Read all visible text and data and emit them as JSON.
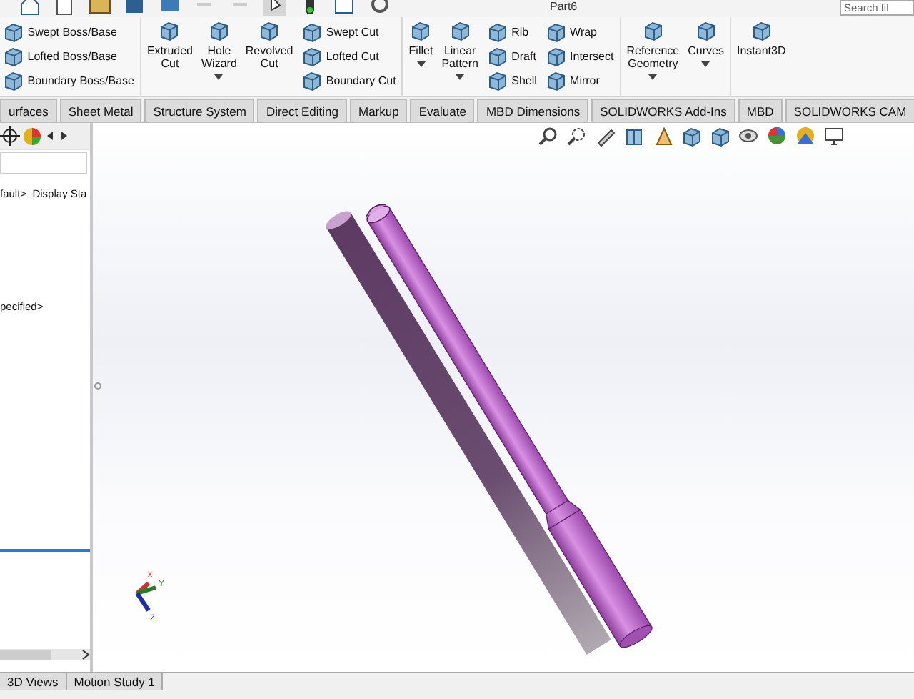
{
  "top_bar": {
    "title": "Part6",
    "search": {
      "placeholder": "Search fil"
    }
  },
  "ribbon": [
    {
      "columns": [
        {
          "kind": "stack",
          "items": [
            {
              "label": "Swept Boss/Base"
            },
            {
              "label": "Lofted Boss/Base"
            },
            {
              "label": "Boundary Boss/Base"
            }
          ]
        }
      ]
    },
    {
      "columns": [
        {
          "kind": "large",
          "label": "Extruded Cut",
          "dropdown": false
        },
        {
          "kind": "large",
          "label": "Hole Wizard",
          "dropdown": true
        },
        {
          "kind": "large",
          "label": "Revolved Cut",
          "dropdown": false
        },
        {
          "kind": "stack",
          "items": [
            {
              "label": "Swept Cut"
            },
            {
              "label": "Lofted Cut"
            },
            {
              "label": "Boundary Cut"
            }
          ]
        }
      ]
    },
    {
      "columns": [
        {
          "kind": "large",
          "label": "Fillet",
          "dropdown": true
        },
        {
          "kind": "large",
          "label": "Linear Pattern",
          "dropdown": true
        },
        {
          "kind": "stack",
          "items": [
            {
              "label": "Rib"
            },
            {
              "label": "Draft"
            },
            {
              "label": "Shell"
            }
          ]
        },
        {
          "kind": "stack",
          "items": [
            {
              "label": "Wrap"
            },
            {
              "label": "Intersect"
            },
            {
              "label": "Mirror"
            }
          ]
        }
      ]
    },
    {
      "columns": [
        {
          "kind": "large",
          "label": "Reference Geometry",
          "dropdown": true
        },
        {
          "kind": "large",
          "label": "Curves",
          "dropdown": true
        }
      ]
    },
    {
      "columns": [
        {
          "kind": "large",
          "label": "Instant3D",
          "dropdown": false
        }
      ]
    }
  ],
  "tabs": [
    {
      "label": "urfaces",
      "selected": false
    },
    {
      "label": "Sheet Metal",
      "selected": false
    },
    {
      "label": "Structure System",
      "selected": false
    },
    {
      "label": "Direct Editing",
      "selected": false
    },
    {
      "label": "Markup",
      "selected": false
    },
    {
      "label": "Evaluate",
      "selected": false
    },
    {
      "label": "MBD Dimensions",
      "selected": false
    },
    {
      "label": "SOLIDWORKS Add-Ins",
      "selected": false
    },
    {
      "label": "MBD",
      "selected": false
    },
    {
      "label": "SOLIDWORKS CAM",
      "selected": false
    }
  ],
  "feature_tree": {
    "items": [
      {
        "label": "fault>_Display Sta"
      },
      {
        "label": "pecified>"
      }
    ]
  },
  "triad": {
    "x": "X",
    "y": "Y",
    "z": "Z"
  },
  "bottom_tabs": [
    {
      "label": "3D Views",
      "selected": false
    },
    {
      "label": "Motion Study 1",
      "selected": false
    }
  ]
}
